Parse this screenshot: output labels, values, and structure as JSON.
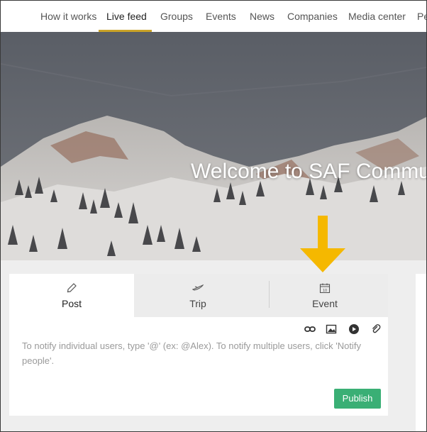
{
  "nav": {
    "items": [
      {
        "label": "How it works"
      },
      {
        "label": "Live feed",
        "active": true
      },
      {
        "label": "Groups"
      },
      {
        "label": "Events"
      },
      {
        "label": "News"
      },
      {
        "label": "Companies"
      },
      {
        "label": "Media center"
      },
      {
        "label": "Pe"
      }
    ],
    "accent_color": "#c9a227"
  },
  "hero": {
    "title": "Welcome to SAF Commu"
  },
  "annotation": {
    "arrow_color": "#f5b800",
    "icon": "down-arrow-icon"
  },
  "composer": {
    "tabs": [
      {
        "label": "Post",
        "icon": "pencil-icon",
        "active": true
      },
      {
        "label": "Trip",
        "icon": "plane-icon"
      },
      {
        "label": "Event",
        "icon": "calendar-icon"
      }
    ],
    "calendar_day": "10",
    "toolbar": [
      "link-icon",
      "image-icon",
      "video-icon",
      "attachment-icon"
    ],
    "placeholder": "To notify individual users, type '@' (ex: @Alex). To notify multiple users, click 'Notify people'.",
    "publish_label": "Publish",
    "publish_color": "#3aaf75"
  }
}
